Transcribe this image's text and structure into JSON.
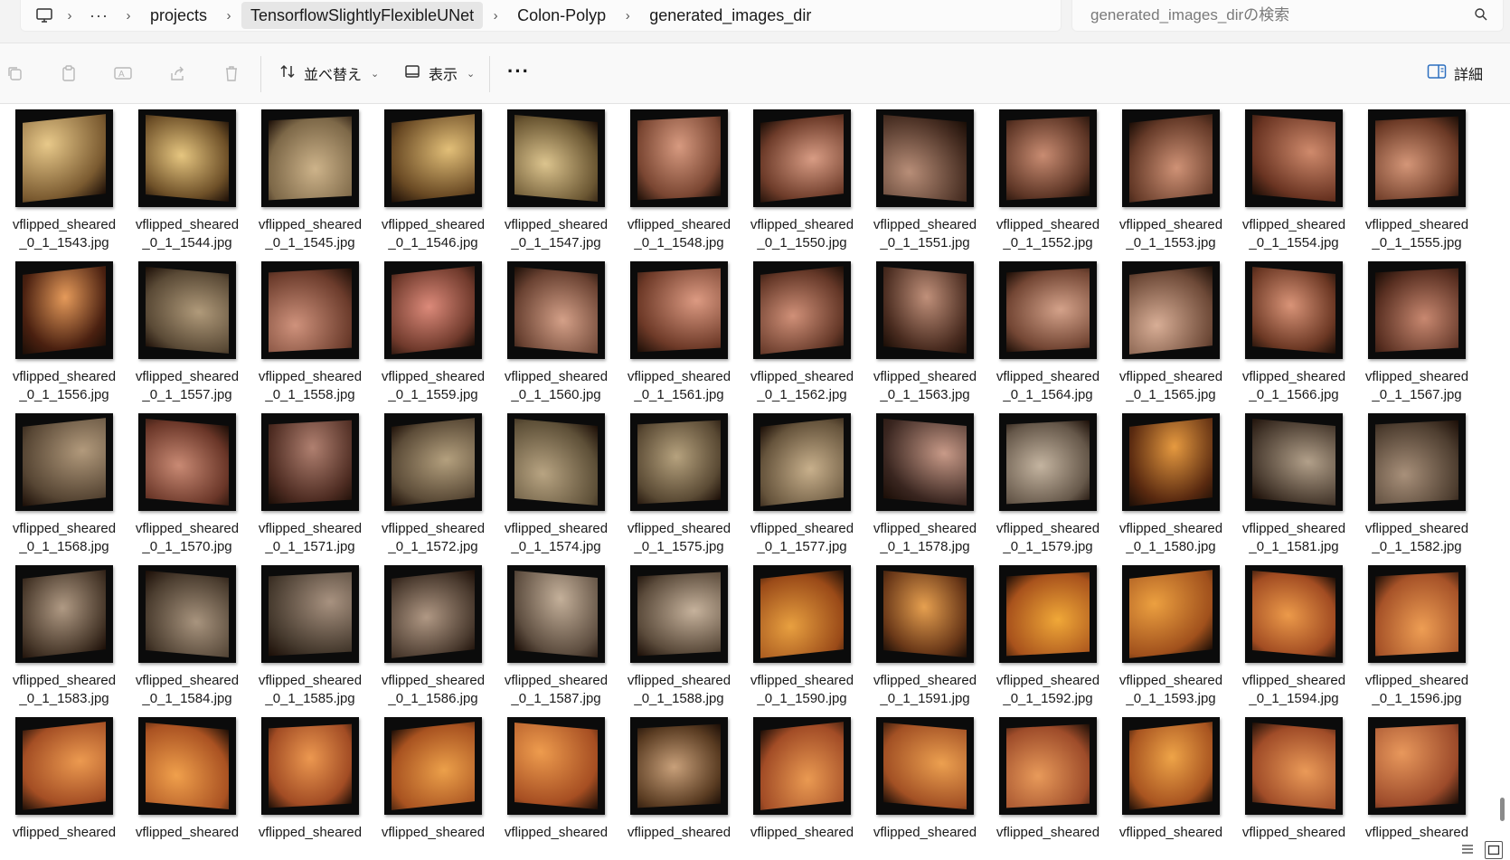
{
  "breadcrumb": {
    "items": [
      "projects",
      "TensorflowSlightlyFlexibleUNet",
      "Colon-Polyp",
      "generated_images_dir"
    ],
    "overflow_label": "···"
  },
  "search": {
    "placeholder": "generated_images_dirの検索",
    "value": ""
  },
  "toolbar": {
    "sort_label": "並べ替え",
    "view_label": "表示",
    "more_label": "···",
    "details_label": "詳細"
  },
  "icons": {
    "computer": "monitor-icon",
    "copy": "copy-icon",
    "paste": "paste-icon",
    "rename": "rename-icon",
    "share": "share-icon",
    "delete": "trash-icon",
    "sort": "sort-arrows-icon",
    "view": "view-icon",
    "details": "details-pane-icon",
    "search": "search-icon"
  },
  "files": [
    {
      "name": "vflipped_sheared\n_0_1_1543.jpg",
      "tone": [
        "#e8c98a",
        "#7a5a30"
      ]
    },
    {
      "name": "vflipped_sheared\n_0_1_1544.jpg",
      "tone": [
        "#e6c680",
        "#6e5028"
      ]
    },
    {
      "name": "vflipped_sheared\n_0_1_1545.jpg",
      "tone": [
        "#cdb38a",
        "#7d6848"
      ]
    },
    {
      "name": "vflipped_sheared\n_0_1_1546.jpg",
      "tone": [
        "#e2bf78",
        "#6a4a24"
      ]
    },
    {
      "name": "vflipped_sheared\n_0_1_1547.jpg",
      "tone": [
        "#dcc48e",
        "#6a5632"
      ]
    },
    {
      "name": "vflipped_sheared\n_0_1_1548.jpg",
      "tone": [
        "#d79a80",
        "#7a4632"
      ]
    },
    {
      "name": "vflipped_sheared\n_0_1_1550.jpg",
      "tone": [
        "#d89c84",
        "#6e3c2a"
      ]
    },
    {
      "name": "vflipped_sheared\n_0_1_1551.jpg",
      "tone": [
        "#b88e78",
        "#4a3024"
      ]
    },
    {
      "name": "vflipped_sheared\n_0_1_1552.jpg",
      "tone": [
        "#c98c72",
        "#5e3626"
      ]
    },
    {
      "name": "vflipped_sheared\n_0_1_1553.jpg",
      "tone": [
        "#cf9276",
        "#653a28"
      ]
    },
    {
      "name": "vflipped_sheared\n_0_1_1554.jpg",
      "tone": [
        "#cf8a6c",
        "#6a3422"
      ]
    },
    {
      "name": "vflipped_sheared\n_0_1_1555.jpg",
      "tone": [
        "#d49678",
        "#6c3a26"
      ]
    },
    {
      "name": "vflipped_sheared\n_0_1_1556.jpg",
      "tone": [
        "#e59a5a",
        "#4a2010"
      ]
    },
    {
      "name": "vflipped_sheared\n_0_1_1557.jpg",
      "tone": [
        "#b09a7a",
        "#5a4a36"
      ]
    },
    {
      "name": "vflipped_sheared\n_0_1_1558.jpg",
      "tone": [
        "#cf927c",
        "#6c3c2c"
      ]
    },
    {
      "name": "vflipped_sheared\n_0_1_1559.jpg",
      "tone": [
        "#dc8a7a",
        "#703a2c"
      ]
    },
    {
      "name": "vflipped_sheared\n_0_1_1560.jpg",
      "tone": [
        "#d4a088",
        "#6a4232"
      ]
    },
    {
      "name": "vflipped_sheared\n_0_1_1561.jpg",
      "tone": [
        "#dc9a82",
        "#6e3a28"
      ]
    },
    {
      "name": "vflipped_sheared\n_0_1_1562.jpg",
      "tone": [
        "#d09078",
        "#653828"
      ]
    },
    {
      "name": "vflipped_sheared\n_0_1_1563.jpg",
      "tone": [
        "#c0907a",
        "#4a2c20"
      ]
    },
    {
      "name": "vflipped_sheared\n_0_1_1564.jpg",
      "tone": [
        "#d4a28a",
        "#734634"
      ]
    },
    {
      "name": "vflipped_sheared\n_0_1_1565.jpg",
      "tone": [
        "#d8ae96",
        "#6e4a38"
      ]
    },
    {
      "name": "vflipped_sheared\n_0_1_1566.jpg",
      "tone": [
        "#d99478",
        "#6c3824"
      ]
    },
    {
      "name": "vflipped_sheared\n_0_1_1567.jpg",
      "tone": [
        "#c88870",
        "#5a3022"
      ]
    },
    {
      "name": "vflipped_sheared\n_0_1_1568.jpg",
      "tone": [
        "#b29a7c",
        "#574634"
      ]
    },
    {
      "name": "vflipped_sheared\n_0_1_1570.jpg",
      "tone": [
        "#c98a74",
        "#6a3628"
      ]
    },
    {
      "name": "vflipped_sheared\n_0_1_1571.jpg",
      "tone": [
        "#b08070",
        "#4e2c22"
      ]
    },
    {
      "name": "vflipped_sheared\n_0_1_1572.jpg",
      "tone": [
        "#b4a07e",
        "#5c4c38"
      ]
    },
    {
      "name": "vflipped_sheared\n_0_1_1574.jpg",
      "tone": [
        "#b8a482",
        "#5e5038"
      ]
    },
    {
      "name": "vflipped_sheared\n_0_1_1575.jpg",
      "tone": [
        "#b6a27e",
        "#5a4a34"
      ]
    },
    {
      "name": "vflipped_sheared\n_0_1_1577.jpg",
      "tone": [
        "#c8b08c",
        "#66543c"
      ]
    },
    {
      "name": "vflipped_sheared\n_0_1_1578.jpg",
      "tone": [
        "#c89a88",
        "#3a2620"
      ]
    },
    {
      "name": "vflipped_sheared\n_0_1_1579.jpg",
      "tone": [
        "#c4b4a0",
        "#66584a"
      ]
    },
    {
      "name": "vflipped_sheared\n_0_1_1580.jpg",
      "tone": [
        "#e69a40",
        "#5a2a10"
      ]
    },
    {
      "name": "vflipped_sheared\n_0_1_1581.jpg",
      "tone": [
        "#b2a08a",
        "#4a3c30"
      ]
    },
    {
      "name": "vflipped_sheared\n_0_1_1582.jpg",
      "tone": [
        "#a8907a",
        "#4e3e30"
      ]
    },
    {
      "name": "vflipped_sheared\n_0_1_1583.jpg",
      "tone": [
        "#b09a84",
        "#4a3a2c"
      ]
    },
    {
      "name": "vflipped_sheared\n_0_1_1584.jpg",
      "tone": [
        "#a8947e",
        "#4c3e30"
      ]
    },
    {
      "name": "vflipped_sheared\n_0_1_1585.jpg",
      "tone": [
        "#a89280",
        "#463a2e"
      ]
    },
    {
      "name": "vflipped_sheared\n_0_1_1586.jpg",
      "tone": [
        "#b09884",
        "#4c3c30"
      ]
    },
    {
      "name": "vflipped_sheared\n_0_1_1587.jpg",
      "tone": [
        "#c4b09a",
        "#5e4e40"
      ]
    },
    {
      "name": "vflipped_sheared\n_0_1_1588.jpg",
      "tone": [
        "#c6b29c",
        "#5c4c3c"
      ]
    },
    {
      "name": "vflipped_sheared\n_0_1_1590.jpg",
      "tone": [
        "#e8a040",
        "#9a4a18"
      ]
    },
    {
      "name": "vflipped_sheared\n_0_1_1591.jpg",
      "tone": [
        "#e6a050",
        "#6a3818"
      ]
    },
    {
      "name": "vflipped_sheared\n_0_1_1592.jpg",
      "tone": [
        "#f0a838",
        "#a8521c"
      ]
    },
    {
      "name": "vflipped_sheared\n_0_1_1593.jpg",
      "tone": [
        "#eca040",
        "#a0501c"
      ]
    },
    {
      "name": "vflipped_sheared\n_0_1_1594.jpg",
      "tone": [
        "#ec9a4a",
        "#a24c22"
      ]
    },
    {
      "name": "vflipped_sheared\n_0_1_1596.jpg",
      "tone": [
        "#ee9e54",
        "#a65228"
      ]
    },
    {
      "name": "vflipped_sheared",
      "tone": [
        "#ec9a50",
        "#a44e24"
      ]
    },
    {
      "name": "vflipped_sheared",
      "tone": [
        "#f0a04c",
        "#aa5222"
      ]
    },
    {
      "name": "vflipped_sheared",
      "tone": [
        "#ec9850",
        "#a24c24"
      ]
    },
    {
      "name": "vflipped_sheared",
      "tone": [
        "#eca04a",
        "#a85220"
      ]
    },
    {
      "name": "vflipped_sheared",
      "tone": [
        "#ee9c4e",
        "#a64e22"
      ]
    },
    {
      "name": "vflipped_sheared",
      "tone": [
        "#c8a07a",
        "#5a3c22"
      ]
    },
    {
      "name": "vflipped_sheared",
      "tone": [
        "#ea9a52",
        "#a24c26"
      ]
    },
    {
      "name": "vflipped_sheared",
      "tone": [
        "#eca050",
        "#a25024"
      ]
    },
    {
      "name": "vflipped_sheared",
      "tone": [
        "#e89a5a",
        "#9e4c2a"
      ]
    },
    {
      "name": "vflipped_sheared",
      "tone": [
        "#eea448",
        "#a85420"
      ]
    },
    {
      "name": "vflipped_sheared",
      "tone": [
        "#ea9a58",
        "#a04c28"
      ]
    },
    {
      "name": "vflipped_sheared",
      "tone": [
        "#e8985c",
        "#9c4a2a"
      ]
    }
  ]
}
